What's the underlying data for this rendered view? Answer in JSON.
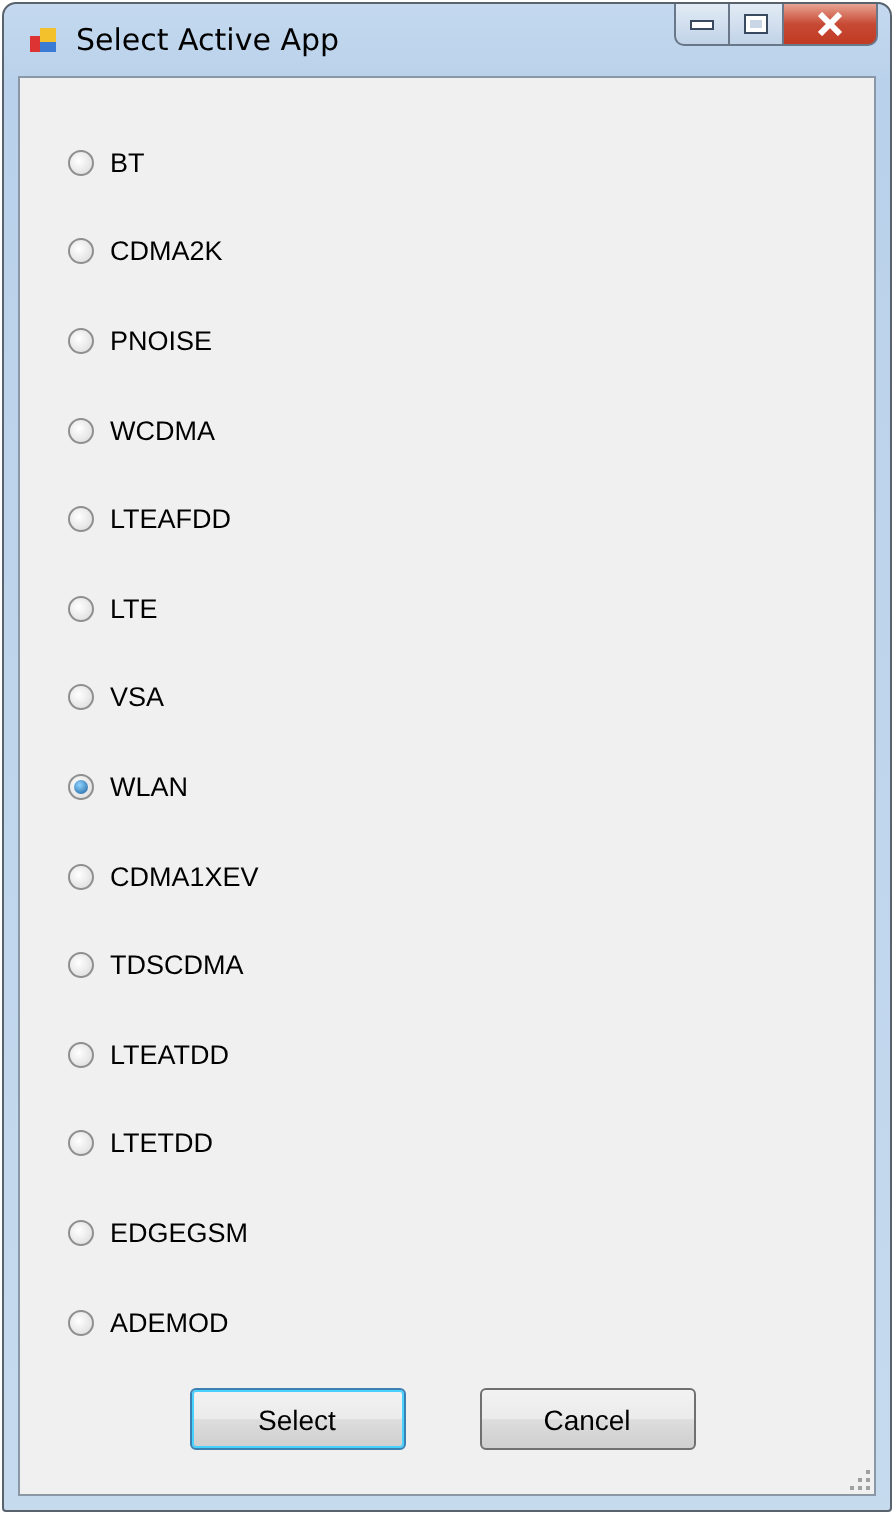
{
  "window": {
    "title": "Select Active App"
  },
  "options": [
    {
      "label": "BT",
      "selected": false
    },
    {
      "label": "CDMA2K",
      "selected": false
    },
    {
      "label": "PNOISE",
      "selected": false
    },
    {
      "label": "WCDMA",
      "selected": false
    },
    {
      "label": "LTEAFDD",
      "selected": false
    },
    {
      "label": "LTE",
      "selected": false
    },
    {
      "label": "VSA",
      "selected": false
    },
    {
      "label": "WLAN",
      "selected": true
    },
    {
      "label": "CDMA1XEV",
      "selected": false
    },
    {
      "label": "TDSCDMA",
      "selected": false
    },
    {
      "label": "LTEATDD",
      "selected": false
    },
    {
      "label": "LTETDD",
      "selected": false
    },
    {
      "label": "EDGEGSM",
      "selected": false
    },
    {
      "label": "ADEMOD",
      "selected": false
    }
  ],
  "buttons": [
    {
      "label": "Select",
      "default": true
    },
    {
      "label": "Cancel",
      "default": false
    }
  ]
}
